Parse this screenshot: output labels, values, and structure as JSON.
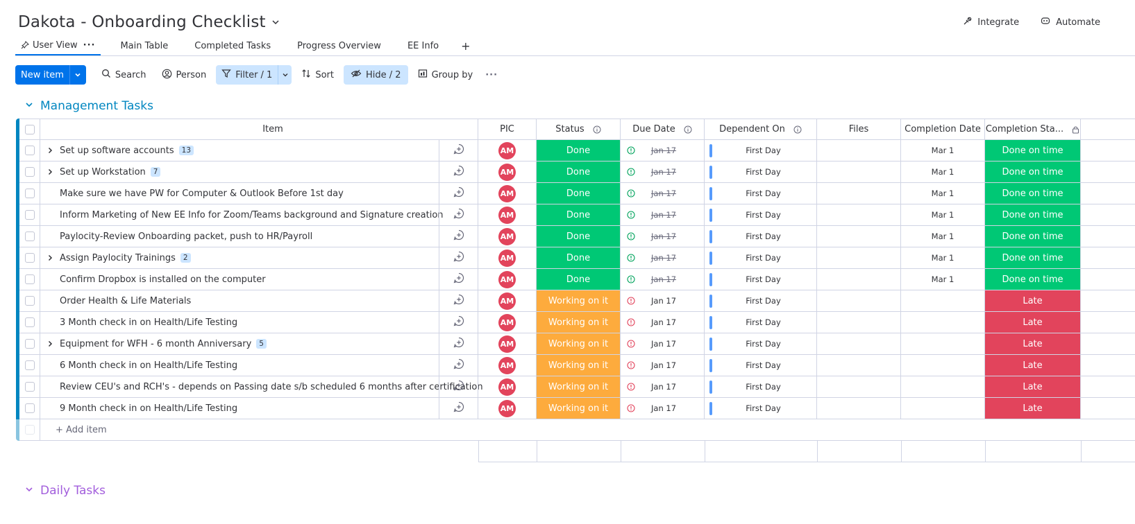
{
  "board": {
    "title": "Dakota - Onboarding Checklist"
  },
  "top_right": {
    "integrate": "Integrate",
    "automate": "Automate"
  },
  "tabs": [
    {
      "label": "User View",
      "active": true
    },
    {
      "label": "Main Table"
    },
    {
      "label": "Completed Tasks"
    },
    {
      "label": "Progress Overview"
    },
    {
      "label": "EE Info"
    }
  ],
  "tab_add": "+",
  "toolbar": {
    "new_item": "New item",
    "search": "Search",
    "person": "Person",
    "filter": "Filter / 1",
    "sort": "Sort",
    "hide": "Hide / 2",
    "group_by": "Group by"
  },
  "groups": {
    "management": "Management Tasks",
    "daily": "Daily Tasks"
  },
  "columns": {
    "item": "Item",
    "pic": "PIC",
    "status": "Status",
    "due_date": "Due Date",
    "dependent_on": "Dependent On",
    "files": "Files",
    "completion_date": "Completion Date",
    "completion_status": "Completion Sta..."
  },
  "add_item": "+ Add item",
  "colors": {
    "done": "#00c875",
    "working": "#fdab3d",
    "late": "#e2445c",
    "accent": "#0073ea",
    "group_management": "#0086c0",
    "group_daily": "#a25ddc"
  },
  "rows": [
    {
      "item": "Set up software accounts",
      "subitems": "13",
      "pic": "AM",
      "status": "Done",
      "due": "Jan 17",
      "dep": "First Day",
      "comp_date": "Mar 1",
      "comp_status": "Done on time"
    },
    {
      "item": "Set up Workstation",
      "subitems": "7",
      "pic": "AM",
      "status": "Done",
      "due": "Jan 17",
      "dep": "First Day",
      "comp_date": "Mar 1",
      "comp_status": "Done on time"
    },
    {
      "item": "Make sure we have PW for Computer & Outlook Before 1st day",
      "subitems": "",
      "pic": "AM",
      "status": "Done",
      "due": "Jan 17",
      "dep": "First Day",
      "comp_date": "Mar 1",
      "comp_status": "Done on time"
    },
    {
      "item": "Inform Marketing of New EE Info for Zoom/Teams background and Signature creation",
      "subitems": "",
      "pic": "AM",
      "status": "Done",
      "due": "Jan 17",
      "dep": "First Day",
      "comp_date": "Mar 1",
      "comp_status": "Done on time"
    },
    {
      "item": "Paylocity-Review Onboarding packet, push to HR/Payroll",
      "subitems": "",
      "pic": "AM",
      "status": "Done",
      "due": "Jan 17",
      "dep": "First Day",
      "comp_date": "Mar 1",
      "comp_status": "Done on time"
    },
    {
      "item": "Assign Paylocity Trainings",
      "subitems": "2",
      "pic": "AM",
      "status": "Done",
      "due": "Jan 17",
      "dep": "First Day",
      "comp_date": "Mar 1",
      "comp_status": "Done on time"
    },
    {
      "item": "Confirm Dropbox is installed on the computer",
      "subitems": "",
      "pic": "AM",
      "status": "Done",
      "due": "Jan 17",
      "dep": "First Day",
      "comp_date": "Mar 1",
      "comp_status": "Done on time"
    },
    {
      "item": "Order Health & Life Materials",
      "subitems": "",
      "pic": "AM",
      "status": "Working on it",
      "due": "Jan 17",
      "dep": "First Day",
      "comp_date": "",
      "comp_status": "Late"
    },
    {
      "item": "3 Month check in on Health/Life Testing",
      "subitems": "",
      "pic": "AM",
      "status": "Working on it",
      "due": "Jan 17",
      "dep": "First Day",
      "comp_date": "",
      "comp_status": "Late"
    },
    {
      "item": "Equipment for WFH - 6 month Anniversary",
      "subitems": "5",
      "pic": "AM",
      "status": "Working on it",
      "due": "Jan 17",
      "dep": "First Day",
      "comp_date": "",
      "comp_status": "Late"
    },
    {
      "item": "6 Month check in on Health/Life Testing",
      "subitems": "",
      "pic": "AM",
      "status": "Working on it",
      "due": "Jan 17",
      "dep": "First Day",
      "comp_date": "",
      "comp_status": "Late"
    },
    {
      "item": "Review CEU's and RCH's - depends on Passing date s/b scheduled 6 months after certification",
      "subitems": "",
      "pic": "AM",
      "status": "Working on it",
      "due": "Jan 17",
      "dep": "First Day",
      "comp_date": "",
      "comp_status": "Late"
    },
    {
      "item": "9 Month check in on Health/Life Testing",
      "subitems": "",
      "pic": "AM",
      "status": "Working on it",
      "due": "Jan 17",
      "dep": "First Day",
      "comp_date": "",
      "comp_status": "Late"
    }
  ]
}
